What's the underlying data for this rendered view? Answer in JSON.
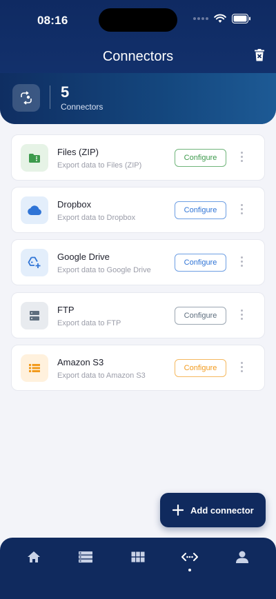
{
  "status_bar": {
    "time": "08:16"
  },
  "header": {
    "title": "Connectors"
  },
  "summary": {
    "count": "5",
    "label": "Connectors"
  },
  "connectors": [
    {
      "name": "Files (ZIP)",
      "description": "Export data to Files (ZIP)",
      "action": "Configure",
      "icon": "folder-zip-icon",
      "accent": "#3d9a4c",
      "icon_bg": "#e6f3e6"
    },
    {
      "name": "Dropbox",
      "description": "Export data to Dropbox",
      "action": "Configure",
      "icon": "cloud-icon",
      "accent": "#2f74d6",
      "icon_bg": "#e3eefb"
    },
    {
      "name": "Google Drive",
      "description": "Export data to Google Drive",
      "action": "Configure",
      "icon": "drive-add-icon",
      "accent": "#2f74d6",
      "icon_bg": "#e3eefb"
    },
    {
      "name": "FTP",
      "description": "Export data to FTP",
      "action": "Configure",
      "icon": "server-icon",
      "accent": "#5e6e7e",
      "icon_bg": "#e8ebef"
    },
    {
      "name": "Amazon S3",
      "description": "Export data to Amazon S3",
      "action": "Configure",
      "icon": "storage-list-icon",
      "accent": "#f29a1c",
      "icon_bg": "#fff1dd"
    }
  ],
  "fab": {
    "label": "Add connector"
  },
  "bottom_nav": {
    "items": [
      "home-icon",
      "storage-icon",
      "grid-icon",
      "connectors-icon",
      "profile-icon"
    ],
    "active": "connectors-icon"
  }
}
